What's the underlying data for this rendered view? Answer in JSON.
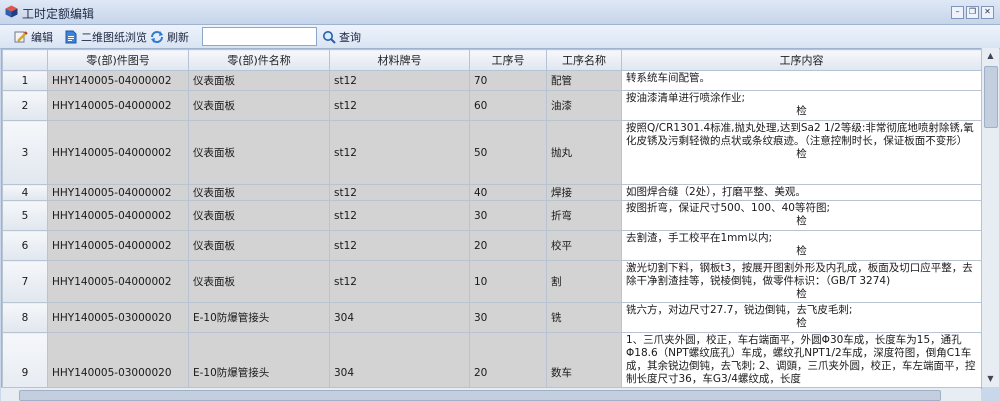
{
  "window": {
    "title": "工时定额编辑"
  },
  "toolbar": {
    "edit_label": "编辑",
    "drawing_label": "二维图纸浏览",
    "refresh_label": "刷新",
    "search_value": "",
    "query_label": "查询"
  },
  "table": {
    "columns": [
      "零(部)件图号",
      "零(部)件名称",
      "材料牌号",
      "工序号",
      "工序名称",
      "工序内容"
    ],
    "rows": [
      {
        "idx": "1",
        "part_no": "HHY140005-04000002",
        "part_name": "仪表面板",
        "material": "st12",
        "op_no": "70",
        "op_name": "配管",
        "content": "转系统车间配管。",
        "check": ""
      },
      {
        "idx": "2",
        "part_no": "HHY140005-04000002",
        "part_name": "仪表面板",
        "material": "st12",
        "op_no": "60",
        "op_name": "油漆",
        "content": "按油漆清单进行喷涂作业;",
        "check": "检"
      },
      {
        "idx": "3",
        "part_no": "HHY140005-04000002",
        "part_name": "仪表面板",
        "material": "st12",
        "op_no": "50",
        "op_name": "抛丸",
        "content": "按照Q/CR1301.4标准,抛丸处理,达到Sa2 1/2等级:非常彻底地喷射除锈,氧化皮锈及污剩轻微的点状或条纹痕迹。（注意控制时长，保证板面不变形）",
        "check": "检"
      },
      {
        "idx": "4",
        "part_no": "HHY140005-04000002",
        "part_name": "仪表面板",
        "material": "st12",
        "op_no": "40",
        "op_name": "焊接",
        "content": "如图焊合缝（2处），打磨平整、美观。",
        "check": ""
      },
      {
        "idx": "5",
        "part_no": "HHY140005-04000002",
        "part_name": "仪表面板",
        "material": "st12",
        "op_no": "30",
        "op_name": "折弯",
        "content": "按图折弯，保证尺寸500、100、40等符图;",
        "check": "检"
      },
      {
        "idx": "6",
        "part_no": "HHY140005-04000002",
        "part_name": "仪表面板",
        "material": "st12",
        "op_no": "20",
        "op_name": "校平",
        "content": "去割渣，手工校平在1mm以内;",
        "check": "检"
      },
      {
        "idx": "7",
        "part_no": "HHY140005-04000002",
        "part_name": "仪表面板",
        "material": "st12",
        "op_no": "10",
        "op_name": "割",
        "content": "激光切割下料，钢板t3，按展开图割外形及内孔成，板面及切口应平整，去除干净割渣挂等，锐棱倒钝，做零件标识：（GB/T 3274)",
        "check": "检"
      },
      {
        "idx": "8",
        "part_no": "HHY140005-03000020",
        "part_name": "E-10防爆管接头",
        "material": "304",
        "op_no": "30",
        "op_name": "铣",
        "content": "铣六方，对边尺寸27.7，锐边倒钝，去飞皮毛刺;",
        "check": "检"
      },
      {
        "idx": "9",
        "part_no": "HHY140005-03000020",
        "part_name": "E-10防爆管接头",
        "material": "304",
        "op_no": "20",
        "op_name": "数车",
        "content": "1、三爪夹外圆，校正，车右端面平，外圆Φ30车成，长度车为15，通孔Φ18.6（NPT螺纹底孔）车成，螺纹孔NPT1/2车成，深度符图，倒角C1车成，其余锐边倒钝，去飞刺; 2、调頭，三爪夹外圆，校正，车左端面平，控制长度尺寸36，车G3/4螺纹成，长度",
        "check": ""
      }
    ]
  },
  "colors": {
    "gray_cell": "#d3d3d3",
    "header_bg": "#dfe6f0",
    "titlebar": "#c6d5ea"
  }
}
